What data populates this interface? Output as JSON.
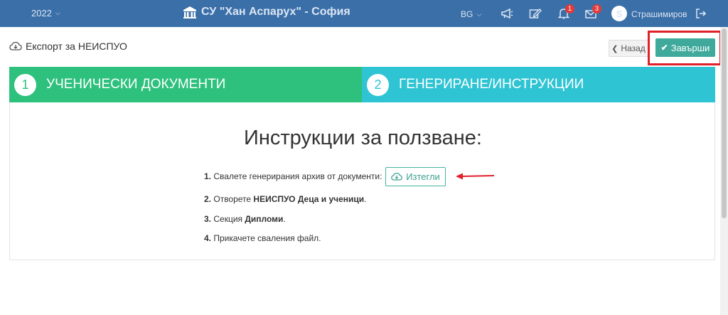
{
  "topbar": {
    "year": "2022",
    "school_name": "СУ \"Хан Аспарух\" - София",
    "language": "BG",
    "notifications_count": "1",
    "messages_count": "3",
    "avatar_letter": "S",
    "username": "Страшимиров"
  },
  "page": {
    "title": "Експорт за НЕИСПУО",
    "back_label": "Назад",
    "finish_label": "Завърши"
  },
  "steps": [
    {
      "number": "1",
      "label": "УЧЕНИЧЕСКИ ДОКУМЕНТИ"
    },
    {
      "number": "2",
      "label": "ГЕНЕРИРАНЕ/ИНСТРУКЦИИ"
    }
  ],
  "instructions": {
    "heading": "Инструкции за ползване:",
    "items": [
      {
        "num": "1.",
        "text": "Свалете генерирания архив от документи:",
        "bold": "",
        "suffix": ""
      },
      {
        "num": "2.",
        "text": "Отворете ",
        "bold": "НЕИСПУО Деца и ученици",
        "suffix": "."
      },
      {
        "num": "3.",
        "text": "Секция ",
        "bold": "Дипломи",
        "suffix": "."
      },
      {
        "num": "4.",
        "text": "Прикачете сваления файл.",
        "bold": "",
        "suffix": ""
      }
    ],
    "download_label": "Изтегли"
  },
  "colors": {
    "topbar": "#3b6fa8",
    "step1": "#2dc17d",
    "step2": "#2fc4d3",
    "finish": "#3fa99c",
    "highlight": "#e0202a"
  }
}
